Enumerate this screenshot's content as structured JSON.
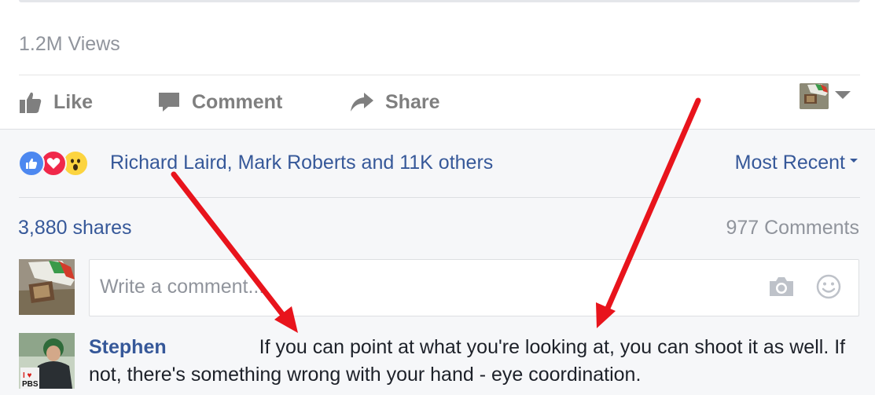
{
  "post": {
    "views": "1.2M Views"
  },
  "actions": {
    "like": "Like",
    "comment": "Comment",
    "share": "Share"
  },
  "feedback": {
    "reactors": "Richard Laird, Mark Roberts and 11K others",
    "sort": "Most Recent",
    "shares": "3,880 shares",
    "comments_count": "977 Comments"
  },
  "composer": {
    "placeholder": "Write a comment..."
  },
  "comment": {
    "author": "Stephen",
    "text": "If you can point at what you're looking at, you can shoot it as well. If not, there's something wrong with your hand - eye coordination."
  },
  "avatar_badge": {
    "line1": "I ♥",
    "line2": "PBS"
  },
  "colors": {
    "link": "#365899",
    "muted": "#90949c",
    "action": "#7f7f7f",
    "feedback_bg": "#f6f7f9",
    "annotation_arrow": "#e8141c"
  },
  "icons": [
    "thumbs-up-icon",
    "speech-bubble-icon",
    "share-arrow-icon",
    "chevron-down-icon",
    "like-reaction-icon",
    "love-reaction-icon",
    "wow-reaction-icon",
    "camera-icon",
    "smiley-icon"
  ]
}
